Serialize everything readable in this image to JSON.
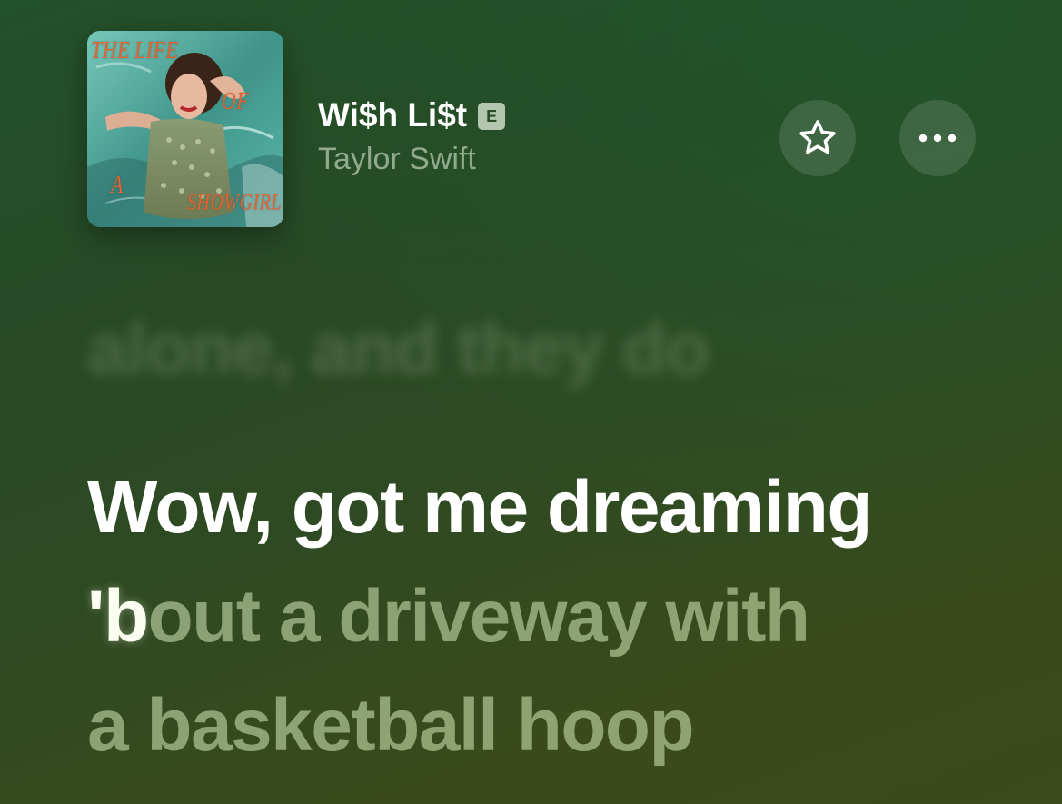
{
  "now_playing": {
    "album_art": {
      "icon": "album-cover",
      "lettering": [
        "THE",
        "LIFE",
        "OF",
        "A",
        "SHOWGIRL"
      ]
    },
    "title": "Wi$h Li$t",
    "explicit_badge": "E",
    "artist": "Taylor Swift"
  },
  "actions": {
    "favorite_icon": "star-outline-icon",
    "more_icon": "ellipsis-icon"
  },
  "lyrics": {
    "previous_line": "alone, and they do",
    "current_line": "Wow, got me dreaming",
    "next_line_1_sung": "'b",
    "next_line_1_rest": "out a driveway with",
    "next_line_2": "a basketball hoop"
  },
  "colors": {
    "background_top": "#23512a",
    "background_bottom": "#3d4a1b",
    "active_lyric": "#ffffff",
    "upcoming_lyric": "#c8deaf"
  }
}
